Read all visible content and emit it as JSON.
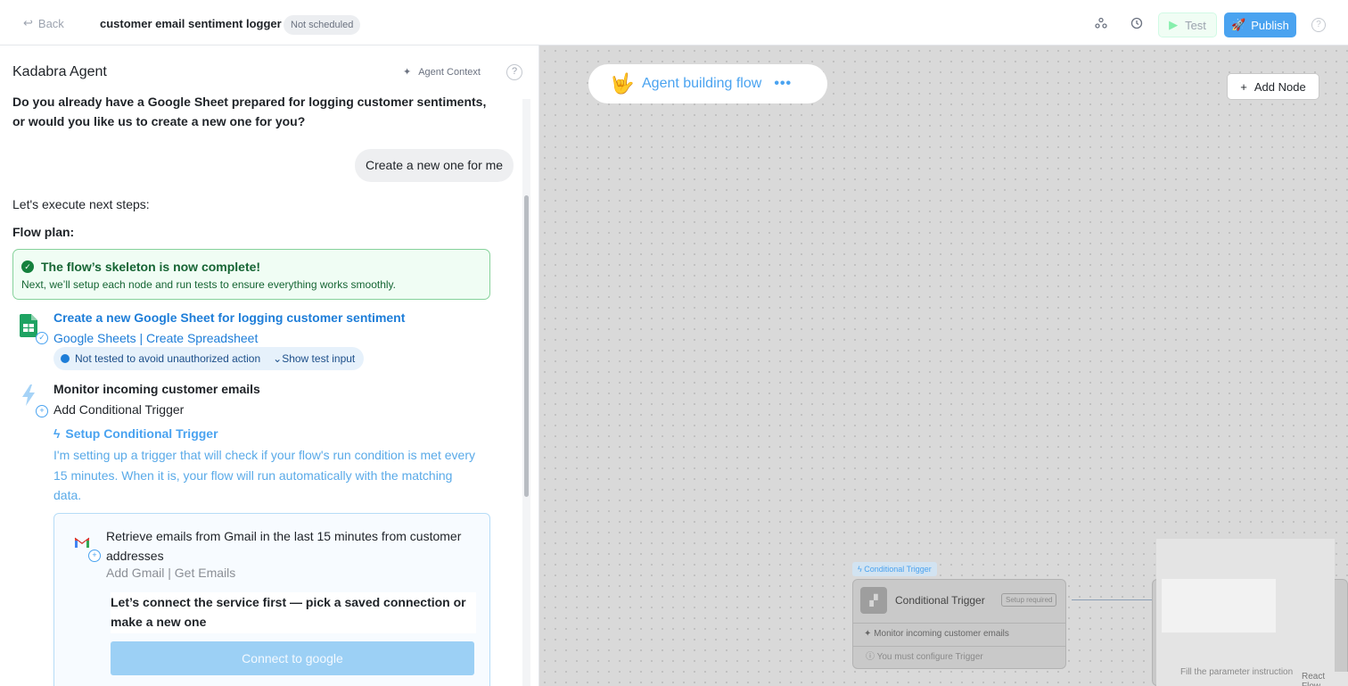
{
  "topbar": {
    "back_label": "Back",
    "flow_title": "customer email sentiment logger",
    "schedule_badge": "Not scheduled",
    "test_label": "Test",
    "publish_label": "Publish"
  },
  "panel": {
    "title": "Kadabra Agent",
    "agent_context_label": "Agent Context"
  },
  "chat": {
    "question": "Do you already have a Google Sheet prepared for logging customer sentiments, or would you like us to create a new one for you?",
    "user_reply": "Create a new one for me",
    "next_steps": "Let's execute next steps:",
    "flow_plan_label": "Flow plan:",
    "success_title": "The flow’s skeleton is now complete!",
    "success_sub": "Next, we’ll setup each node and run tests to ensure everything works smoothly."
  },
  "steps": [
    {
      "title": "Create a new Google Sheet for logging customer sentiment",
      "subtitle": "Google Sheets | Create Spreadsheet",
      "status": "Not tested to avoid unauthorized action",
      "toggle": "Show test input",
      "icon": "google-sheets-icon"
    },
    {
      "title": "Monitor incoming customer emails",
      "subtitle": "Add Conditional Trigger",
      "setup_title": "Setup Conditional Trigger",
      "setup_desc": "I'm setting up a trigger that will check if your flow's run condition is met every 15 minutes. When it is, your flow will run automatically with the matching data.",
      "icon": "lightning-icon"
    }
  ],
  "gmail_card": {
    "title": "Retrieve emails from Gmail in the last 15 minutes from customer addresses",
    "subtitle": "Add Gmail | Get Emails",
    "note": "Let’s connect the service first — pick a saved connection or make a new one",
    "button": "Connect to google"
  },
  "canvas": {
    "agent_pill": "Agent building flow",
    "add_node": "Add Node",
    "node": {
      "tag": "Conditional Trigger",
      "title": "Conditional Trigger",
      "badge": "Setup required",
      "row1": "Monitor incoming customer emails",
      "row2": "You must configure Trigger"
    },
    "node2_text": "Fill the parameter instruction",
    "footer": "React Flow"
  },
  "colors": {
    "accent": "#4aa3f0",
    "link_blue": "#1d7dd8",
    "success_green": "#166534"
  }
}
